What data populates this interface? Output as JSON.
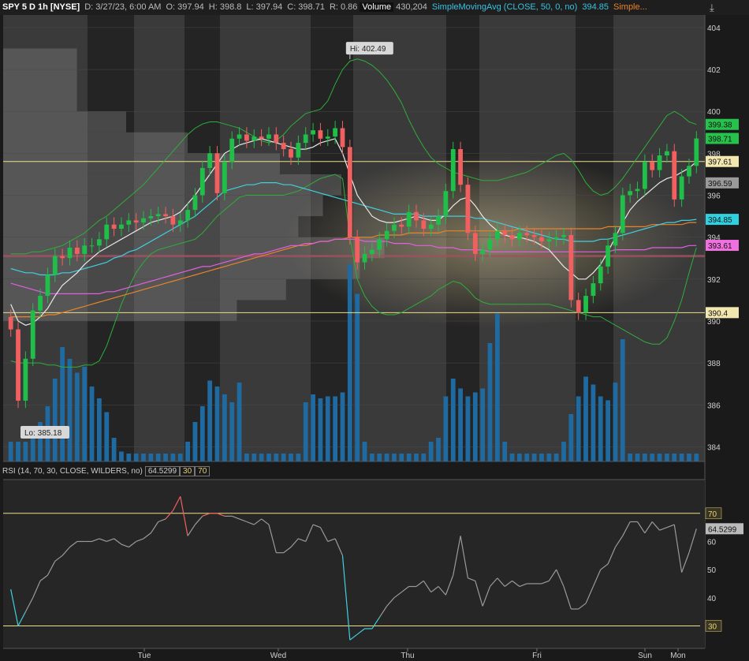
{
  "header": {
    "symbol": "SPY 5 D 1h [NYSE]",
    "date": "D: 3/27/23, 6:00 AM",
    "open": "O: 397.94",
    "high": "H: 398.8",
    "low": "L: 397.94",
    "close": "C: 398.71",
    "range": "R: 0.86",
    "volume_label": "Volume",
    "volume_value": "430,204",
    "sma50_label": "SimpleMovingAvg (CLOSE, 50, 0, no)",
    "sma50_value": "394.85",
    "sma200_label": "Simple..."
  },
  "rsi_header": {
    "label": "RSI (14, 70, 30, CLOSE, WILDERS, no)",
    "value": "64.5299",
    "lower": "30",
    "upper": "70"
  },
  "colors": {
    "up": "#1fbf4a",
    "down": "#f06060",
    "sma9": "#e8e8e8",
    "sma50": "#3fd0e0",
    "sma200": "#e8832a",
    "ema": "#e060e0",
    "bollinger": "#2fae3a",
    "volume": "#1f6aa0",
    "rsi": "#9a9a9a",
    "hline": "#f0dd8a"
  },
  "chart_data": [
    {
      "type": "candlestick",
      "title": "SPY 5 D 1h [NYSE]",
      "ylim": [
        383.3,
        404.6
      ],
      "yticks": [
        384,
        386,
        388,
        390,
        392,
        394,
        396,
        398,
        400,
        402,
        404
      ],
      "xticks": [
        "Tue",
        "Wed",
        "Thu",
        "Fri",
        "Sun",
        "Mon"
      ],
      "annotations": {
        "high": "Hi: 402.49",
        "low": "Lo: 385.18"
      },
      "price_tags": [
        {
          "value": 399.38,
          "text": "399.38",
          "color": "#27c24c"
        },
        {
          "value": 398.71,
          "text": "398.71",
          "color": "#27c24c"
        },
        {
          "value": 397.61,
          "text": "397.61",
          "color": "#f3e7b0"
        },
        {
          "value": 396.59,
          "text": "396.59",
          "color": "#9a9a9a"
        },
        {
          "value": 394.85,
          "text": "394.85",
          "color": "#2fd0e0"
        },
        {
          "value": 393.61,
          "text": "393.61",
          "color": "#f070e0"
        },
        {
          "value": 390.4,
          "text": "390.4",
          "color": "#f3e7b0"
        }
      ],
      "hlines": [
        397.61,
        390.4,
        393.1
      ],
      "close": [
        389.6,
        386.2,
        388.2,
        390.5,
        391.2,
        392.2,
        393.1,
        393.0,
        393.5,
        393.2,
        393.6,
        393.6,
        393.9,
        394.6,
        394.4,
        394.6,
        394.8,
        394.7,
        394.9,
        395.0,
        395.1,
        395.0,
        394.6,
        394.8,
        395.3,
        396.0,
        397.3,
        398.0,
        396.1,
        397.6,
        398.7,
        398.9,
        398.6,
        398.8,
        398.7,
        398.9,
        398.5,
        398.2,
        397.8,
        398.5,
        398.9,
        399.1,
        398.7,
        398.8,
        399.2,
        398.3,
        394.0,
        392.8,
        393.2,
        393.4,
        393.9,
        394.3,
        394.6,
        394.5,
        395.2,
        394.8,
        394.4,
        394.6,
        395.0,
        396.2,
        398.2,
        396.5,
        394.2,
        393.2,
        393.4,
        393.9,
        394.3,
        394.1,
        393.9,
        394.2,
        394.1,
        394.0,
        393.8,
        393.9,
        394.0,
        394.1,
        391.0,
        390.4,
        391.2,
        391.8,
        392.6,
        393.6,
        394.2,
        396.0,
        396.2,
        396.3,
        397.6,
        397.2,
        397.9,
        398.1,
        395.8,
        396.9,
        397.4,
        398.71
      ],
      "sma9": [
        390.8,
        390.0,
        389.8,
        389.9,
        390.2,
        390.6,
        391.2,
        391.7,
        392.0,
        392.3,
        392.7,
        393.0,
        393.3,
        393.5,
        393.7,
        393.9,
        394.1,
        394.3,
        394.5,
        394.7,
        394.8,
        394.9,
        395.0,
        395.2,
        395.6,
        396.0,
        396.5,
        397.0,
        397.5,
        398.0,
        398.2,
        398.4,
        398.5,
        398.6,
        398.7,
        398.6,
        398.5,
        398.4,
        398.3,
        398.2,
        398.2,
        398.3,
        398.5,
        398.6,
        398.7,
        398.0,
        397.0,
        396.0,
        395.5,
        395.0,
        394.8,
        394.7,
        394.7,
        394.8,
        394.9,
        395.0,
        394.9,
        394.8,
        394.8,
        395.1,
        395.5,
        395.8,
        395.9,
        395.5,
        395.0,
        394.6,
        394.3,
        394.1,
        394.0,
        394.0,
        393.9,
        393.8,
        393.6,
        393.4,
        393.0,
        392.6,
        392.3,
        392.0,
        392.0,
        392.3,
        392.7,
        393.3,
        394.0,
        394.7,
        395.3,
        395.7,
        396.0,
        396.3,
        396.6,
        396.8,
        396.9,
        397.1,
        397.3,
        397.6
      ],
      "sma50": [
        392.5,
        392.4,
        392.3,
        392.3,
        392.2,
        392.2,
        392.2,
        392.3,
        392.3,
        392.4,
        392.5,
        392.6,
        392.7,
        392.8,
        393.0,
        393.1,
        393.3,
        393.4,
        393.6,
        393.8,
        394.0,
        394.2,
        394.4,
        394.6,
        394.8,
        395.0,
        395.3,
        395.6,
        395.9,
        396.2,
        396.3,
        396.4,
        396.5,
        396.5,
        396.6,
        396.6,
        396.6,
        396.5,
        396.5,
        396.4,
        396.3,
        396.2,
        396.1,
        396.0,
        395.9,
        395.8,
        395.7,
        395.6,
        395.5,
        395.4,
        395.3,
        395.2,
        395.1,
        395.1,
        395.1,
        395.1,
        395.0,
        395.0,
        395.0,
        395.0,
        395.0,
        395.0,
        395.0,
        394.9,
        394.9,
        394.8,
        394.7,
        394.6,
        394.5,
        394.4,
        394.3,
        394.2,
        394.1,
        394.0,
        393.9,
        393.9,
        393.8,
        393.8,
        393.8,
        393.8,
        393.9,
        393.9,
        394.0,
        394.1,
        394.2,
        394.3,
        394.4,
        394.5,
        394.6,
        394.7,
        394.7,
        394.8,
        394.8,
        394.85
      ],
      "sma200": [
        390.2,
        390.2,
        390.2,
        390.2,
        390.2,
        390.3,
        390.3,
        390.4,
        390.5,
        390.6,
        390.7,
        390.8,
        390.9,
        391.0,
        391.1,
        391.2,
        391.3,
        391.4,
        391.5,
        391.6,
        391.7,
        391.8,
        391.9,
        392.0,
        392.1,
        392.2,
        392.3,
        392.4,
        392.5,
        392.6,
        392.7,
        392.8,
        392.9,
        393.0,
        393.1,
        393.2,
        393.3,
        393.4,
        393.5,
        393.6,
        393.6,
        393.7,
        393.8,
        393.8,
        393.9,
        393.9,
        394.0,
        394.0,
        394.0,
        394.0,
        394.1,
        394.1,
        394.1,
        394.1,
        394.2,
        394.2,
        394.2,
        394.2,
        394.2,
        394.3,
        394.3,
        394.3,
        394.3,
        394.3,
        394.3,
        394.3,
        394.3,
        394.3,
        394.3,
        394.4,
        394.4,
        394.4,
        394.4,
        394.4,
        394.4,
        394.4,
        394.4,
        394.4,
        394.4,
        394.4,
        394.4,
        394.5,
        394.5,
        394.5,
        394.5,
        394.5,
        394.5,
        394.6,
        394.6,
        394.6,
        394.6,
        394.6,
        394.7,
        394.7
      ],
      "ema": [
        391.8,
        391.7,
        391.6,
        391.5,
        391.4,
        391.3,
        391.3,
        391.3,
        391.3,
        391.3,
        391.3,
        391.3,
        391.3,
        391.4,
        391.4,
        391.5,
        391.6,
        391.7,
        391.8,
        391.9,
        392.0,
        392.1,
        392.2,
        392.3,
        392.4,
        392.5,
        392.6,
        392.6,
        392.7,
        392.8,
        392.9,
        393.0,
        393.1,
        393.2,
        393.2,
        393.3,
        393.4,
        393.5,
        393.6,
        393.6,
        393.7,
        393.7,
        393.8,
        393.8,
        393.9,
        393.9,
        393.9,
        393.9,
        393.8,
        393.8,
        393.8,
        393.8,
        393.7,
        393.7,
        393.7,
        393.6,
        393.6,
        393.6,
        393.5,
        393.5,
        393.5,
        393.4,
        393.4,
        393.4,
        393.4,
        393.3,
        393.3,
        393.3,
        393.3,
        393.3,
        393.3,
        393.3,
        393.3,
        393.3,
        393.3,
        393.3,
        393.3,
        393.3,
        393.3,
        393.3,
        393.3,
        393.3,
        393.4,
        393.4,
        393.4,
        393.4,
        393.4,
        393.5,
        393.5,
        393.5,
        393.5,
        393.5,
        393.6,
        393.6
      ],
      "bollinger_upper": [
        393.2,
        393.2,
        393.2,
        393.3,
        393.3,
        393.4,
        393.5,
        393.6,
        393.8,
        394.0,
        394.2,
        394.5,
        394.8,
        395.0,
        395.3,
        395.6,
        395.9,
        396.2,
        396.5,
        396.9,
        397.3,
        397.7,
        398.1,
        398.5,
        398.9,
        399.2,
        399.4,
        399.5,
        399.5,
        399.4,
        399.3,
        399.2,
        399.0,
        398.8,
        398.6,
        398.5,
        398.6,
        398.9,
        399.3,
        399.6,
        399.9,
        400.0,
        400.1,
        400.5,
        401.3,
        402.0,
        402.4,
        402.5,
        402.4,
        402.2,
        401.9,
        401.5,
        401.0,
        400.4,
        399.6,
        398.9,
        398.3,
        397.8,
        397.5,
        397.3,
        397.1,
        397.0,
        396.9,
        396.8,
        396.7,
        396.7,
        396.7,
        396.8,
        396.9,
        397.0,
        397.1,
        397.3,
        397.5,
        397.7,
        397.9,
        398.0,
        397.7,
        397.2,
        396.6,
        396.2,
        396.0,
        396.1,
        396.4,
        396.8,
        397.3,
        397.8,
        398.3,
        398.8,
        399.3,
        399.8,
        400.0,
        399.8,
        399.5,
        399.38
      ],
      "bollinger_lower": [
        388.1,
        388.0,
        388.0,
        388.0,
        388.0,
        387.9,
        387.9,
        387.8,
        387.8,
        387.8,
        387.9,
        387.9,
        388.1,
        388.8,
        389.8,
        390.8,
        391.6,
        392.3,
        392.8,
        393.2,
        393.4,
        393.5,
        393.6,
        393.7,
        393.8,
        393.9,
        394.2,
        394.6,
        395.0,
        395.3,
        395.6,
        395.9,
        396.0,
        396.0,
        396.0,
        396.0,
        396.0,
        396.0,
        396.1,
        396.2,
        396.4,
        396.6,
        396.8,
        396.9,
        397.0,
        396.8,
        394.0,
        392.0,
        391.2,
        390.7,
        390.4,
        390.3,
        390.3,
        390.4,
        390.6,
        390.8,
        391.0,
        391.2,
        391.5,
        391.7,
        391.9,
        391.8,
        391.5,
        391.1,
        390.9,
        390.8,
        390.8,
        390.8,
        390.8,
        390.8,
        390.8,
        390.8,
        390.8,
        390.8,
        390.7,
        390.6,
        390.5,
        390.4,
        390.3,
        390.2,
        390.2,
        390.0,
        389.8,
        389.6,
        389.4,
        389.2,
        389.0,
        388.9,
        388.9,
        389.2,
        390.0,
        391.0,
        392.3,
        393.5
      ],
      "volume": [
        0.1,
        0.1,
        0.1,
        0.12,
        0.2,
        0.28,
        0.42,
        0.58,
        0.52,
        0.45,
        0.48,
        0.38,
        0.32,
        0.25,
        0.12,
        0.05,
        0.04,
        0.04,
        0.04,
        0.04,
        0.04,
        0.04,
        0.04,
        0.04,
        0.1,
        0.2,
        0.28,
        0.41,
        0.38,
        0.34,
        0.3,
        0.4,
        0.04,
        0.04,
        0.04,
        0.04,
        0.04,
        0.04,
        0.04,
        0.04,
        0.3,
        0.34,
        0.32,
        0.33,
        0.33,
        0.35,
        1.0,
        0.85,
        0.1,
        0.04,
        0.04,
        0.04,
        0.04,
        0.04,
        0.04,
        0.04,
        0.04,
        0.1,
        0.12,
        0.33,
        0.42,
        0.37,
        0.33,
        0.35,
        0.37,
        0.6,
        0.75,
        0.1,
        0.04,
        0.04,
        0.04,
        0.04,
        0.04,
        0.04,
        0.04,
        0.1,
        0.24,
        0.33,
        0.43,
        0.39,
        0.33,
        0.31,
        0.4,
        0.62,
        0.04,
        0.04,
        0.04,
        0.04,
        0.04,
        0.04,
        0.04,
        0.04,
        0.04,
        0.04
      ]
    },
    {
      "type": "line",
      "title": "RSI (14, 70, 30, CLOSE, WILDERS, no)",
      "ylim": [
        22,
        82
      ],
      "yticks": [
        40,
        50,
        60
      ],
      "levels": [
        30,
        70
      ],
      "values": [
        43,
        30,
        35,
        40,
        46,
        48,
        53,
        55,
        58,
        60,
        60,
        60,
        61,
        60,
        61,
        59,
        58,
        60,
        61,
        63,
        67,
        68,
        71,
        76,
        62,
        66,
        69,
        70,
        70,
        69,
        69,
        68,
        67,
        66,
        68,
        66,
        56,
        56,
        58,
        61,
        60,
        66,
        65,
        60,
        61,
        55,
        25,
        27,
        29,
        29,
        33,
        37,
        40,
        42,
        44,
        44,
        46,
        42,
        44,
        41,
        48,
        62,
        47,
        46,
        37,
        44,
        47,
        44,
        46,
        44,
        45,
        45,
        45,
        46,
        50,
        44,
        36,
        36,
        38,
        44,
        50,
        52,
        58,
        62,
        67,
        67,
        63,
        67,
        64,
        65,
        66,
        49,
        56,
        64.53
      ]
    }
  ]
}
